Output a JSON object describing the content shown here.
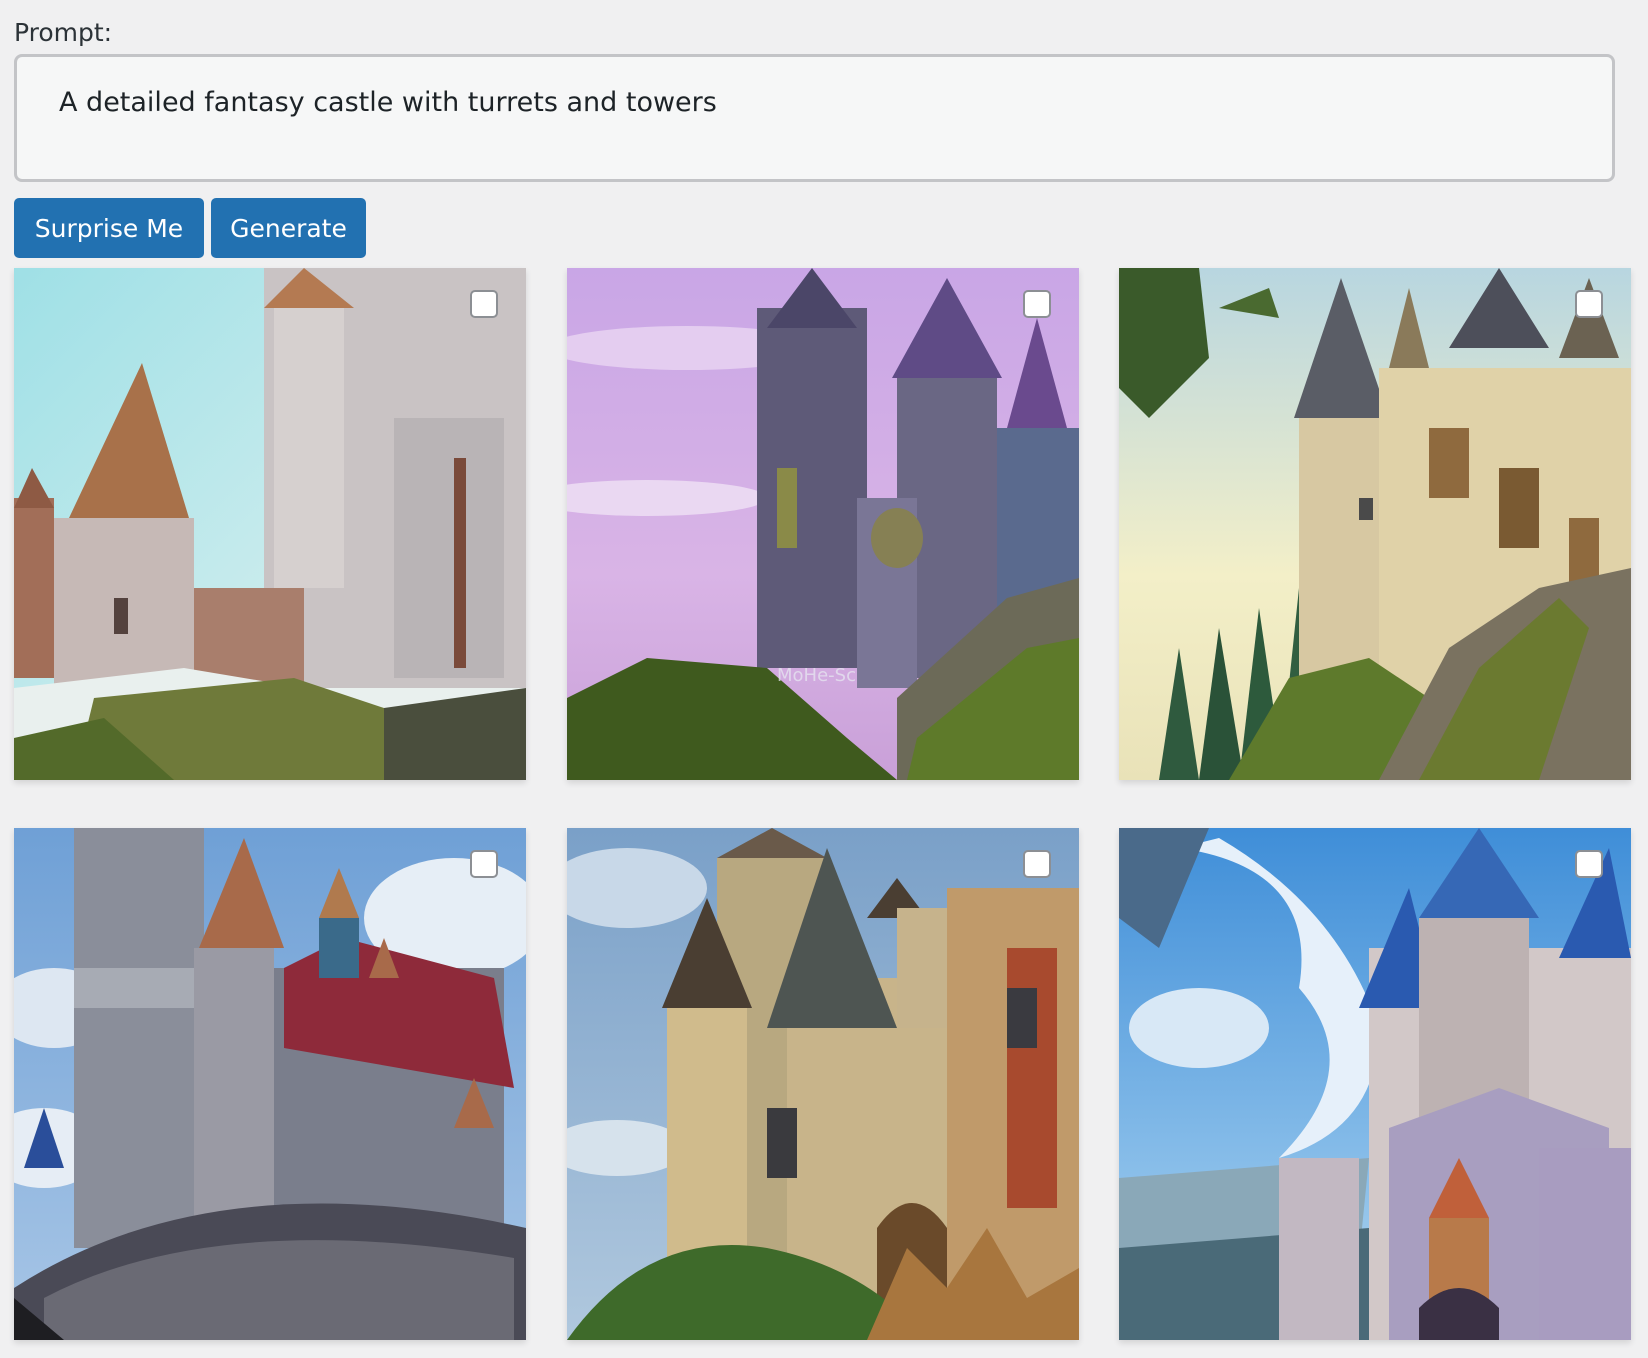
{
  "prompt": {
    "label": "Prompt:",
    "value": "A detailed fantasy castle with turrets and towers"
  },
  "buttons": {
    "surprise_label": "Surprise Me",
    "generate_label": "Generate"
  },
  "images": [
    {
      "alt": "castle-image-1",
      "selected": false
    },
    {
      "alt": "castle-image-2",
      "selected": false,
      "watermark": "MoHe-Sc"
    },
    {
      "alt": "castle-image-3",
      "selected": false
    },
    {
      "alt": "castle-image-4",
      "selected": false
    },
    {
      "alt": "castle-image-5",
      "selected": false
    },
    {
      "alt": "castle-image-6",
      "selected": false
    }
  ],
  "colors": {
    "button": "#2271b1",
    "background": "#f0f0f1"
  }
}
